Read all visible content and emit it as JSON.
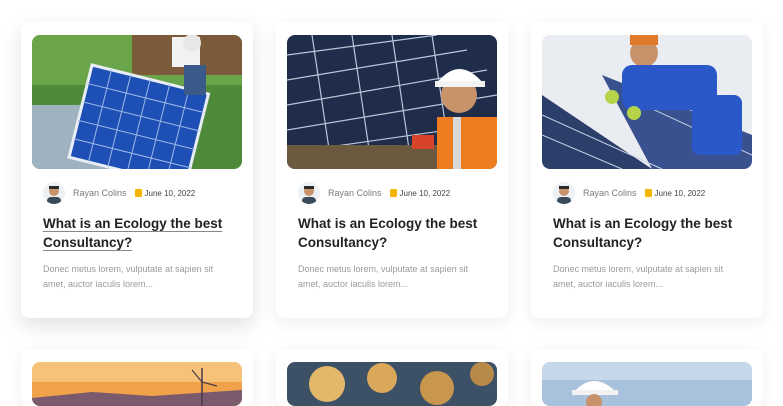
{
  "posts": [
    {
      "author": "Rayan Colins",
      "date": "June 10, 2022",
      "title": "What is an Ecology the best Consultancy?",
      "excerpt": "Donec metus lorem, vulputate at sapien sit amet, auctor iaculis lorem..."
    },
    {
      "author": "Rayan Colins",
      "date": "June 10, 2022",
      "title": "What is an Ecology the best Consultancy?",
      "excerpt": "Donec metus lorem, vulputate at sapien sit amet, auctor iaculis lorem..."
    },
    {
      "author": "Rayan Colins",
      "date": "June 10, 2022",
      "title": "What is an Ecology the best Consultancy?",
      "excerpt": "Donec metus lorem, vulputate at sapien sit amet, auctor iaculis lorem..."
    }
  ],
  "icons": {
    "date": "calendar-icon",
    "author": "avatar"
  },
  "colors": {
    "accent": "#f4b400",
    "title": "#222222",
    "text": "#9a9a9a"
  }
}
